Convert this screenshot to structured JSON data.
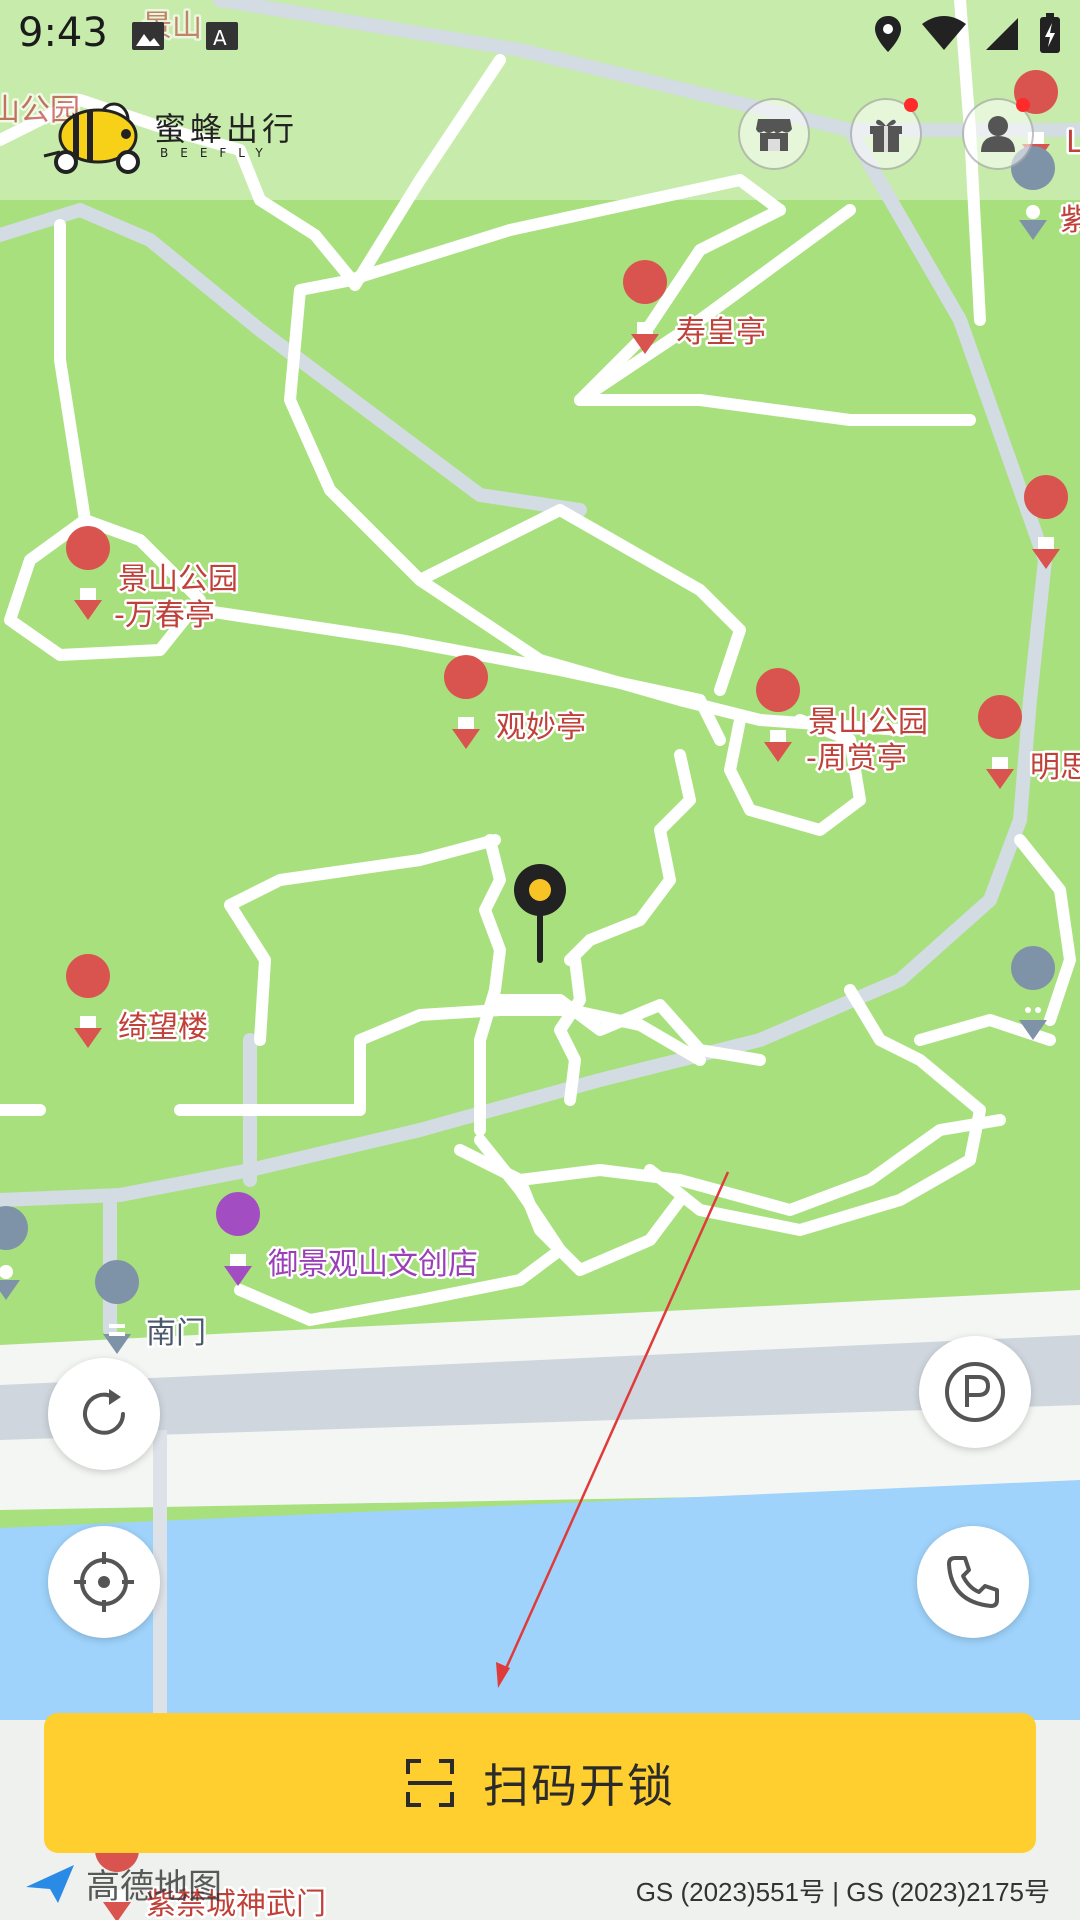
{
  "status_bar": {
    "time": "9:43"
  },
  "header": {
    "brand_cn": "蜜蜂出行",
    "brand_en": "BEEFLY"
  },
  "map": {
    "pois": [
      {
        "label": "寿皇亭"
      },
      {
        "label": "景山公园"
      },
      {
        "label": "-万春亭"
      },
      {
        "label": "观妙亭"
      },
      {
        "label": "景山公园"
      },
      {
        "label": "-周赏亭"
      },
      {
        "label": "明思"
      },
      {
        "label": "绮望楼"
      },
      {
        "label": "御景观山文创店"
      },
      {
        "label": "南门"
      },
      {
        "label": "紫禁城神武门"
      },
      {
        "label": "景山"
      },
      {
        "label": "山公园"
      },
      {
        "label": "紫"
      },
      {
        "label": "L"
      }
    ]
  },
  "actions": {
    "scan_label": "扫码开锁"
  },
  "footer": {
    "map_provider": "高德地图",
    "copyright": "GS (2023)551号 | GS (2023)2175号"
  },
  "colors": {
    "accent": "#fecf2e",
    "park": "#a8e07e",
    "water": "#9fd3fb",
    "poi": "#d9534f"
  }
}
